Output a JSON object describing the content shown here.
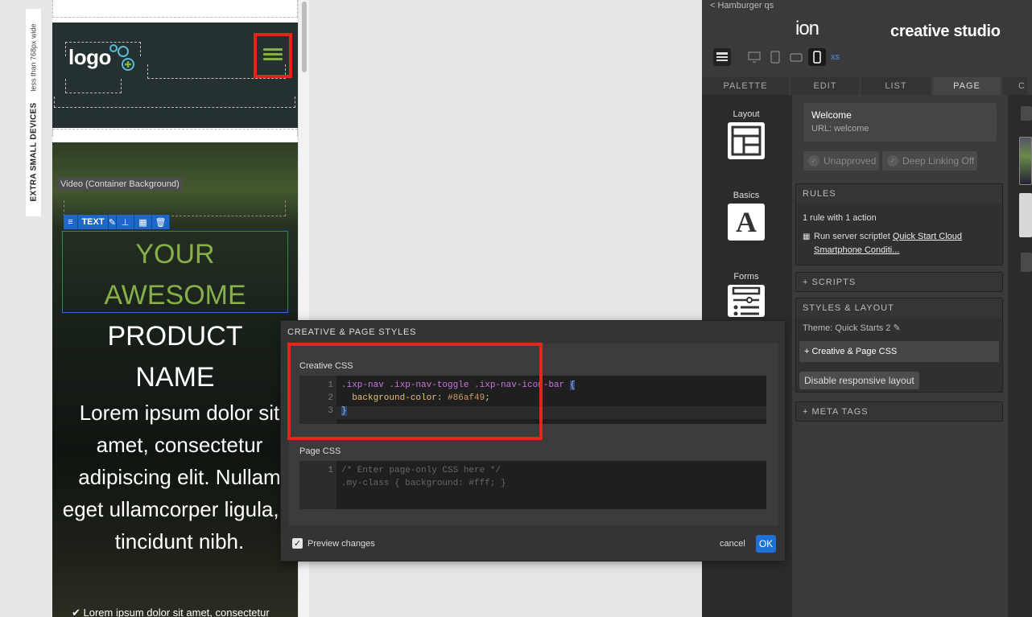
{
  "device_label": {
    "main": "EXTRA SMALL DEVICES",
    "sub": "less than 768px wide"
  },
  "preview": {
    "logo_text": "logo",
    "video_label": "Video (Container Background)",
    "text_toolbar": {
      "text_label": "TEXT"
    },
    "hero_title_green": [
      "YOUR",
      "AWESOME"
    ],
    "hero_title_white": [
      "PRODUCT",
      "NAME"
    ],
    "hero_body": "Lorem ipsum dolor sit amet, consectetur adipiscing elit. Nullam eget ullamcorper ligula, a tincidunt nibh.",
    "hero_footer": "✔ Lorem ipsum dolor sit amet, consectetur",
    "accent_color": "#86af49"
  },
  "studio": {
    "back_link": "< Hamburger qs",
    "brand": "ion",
    "product": "creative studio",
    "device_size": "xs",
    "tabs": [
      "PALETTE",
      "EDIT",
      "LIST",
      "PAGE"
    ],
    "active_tab": "PAGE",
    "palette": {
      "layout": "Layout",
      "basics": "Basics",
      "forms": "Forms"
    },
    "page": {
      "title": "Welcome",
      "url": "URL: welcome",
      "unapproved": "Unapproved",
      "deep_linking": "Deep Linking Off"
    },
    "rules": {
      "header": "RULES",
      "summary": "1 rule with 1 action",
      "action_prefix": "Run server scriptlet",
      "action_link": "Quick Start Cloud Smartphone Conditi..."
    },
    "scripts_header": "+ SCRIPTS",
    "styles_layout": {
      "header": "STYLES & LAYOUT",
      "theme": "Theme: Quick Starts 2",
      "css_item": "+ Creative & Page CSS",
      "disable_btn": "Disable responsive layout"
    },
    "meta_tags_header": "+ META TAGS"
  },
  "modal": {
    "title": "CREATIVE & PAGE STYLES",
    "creative_label": "Creative CSS",
    "creative_code": {
      "line1_selector": ".ixp-nav .ixp-nav-toggle .ixp-nav-icon-bar",
      "line1_brace": "{",
      "line2_prop": "background-color:",
      "line2_value": "#86af49",
      "line2_semi": ";",
      "line3_brace": "}"
    },
    "page_label": "Page CSS",
    "page_code": {
      "line1": "/* Enter page-only CSS here */",
      "line2": ".my-class { background: #fff; }"
    },
    "preview_changes": "Preview changes",
    "cancel": "cancel",
    "ok": "OK"
  }
}
